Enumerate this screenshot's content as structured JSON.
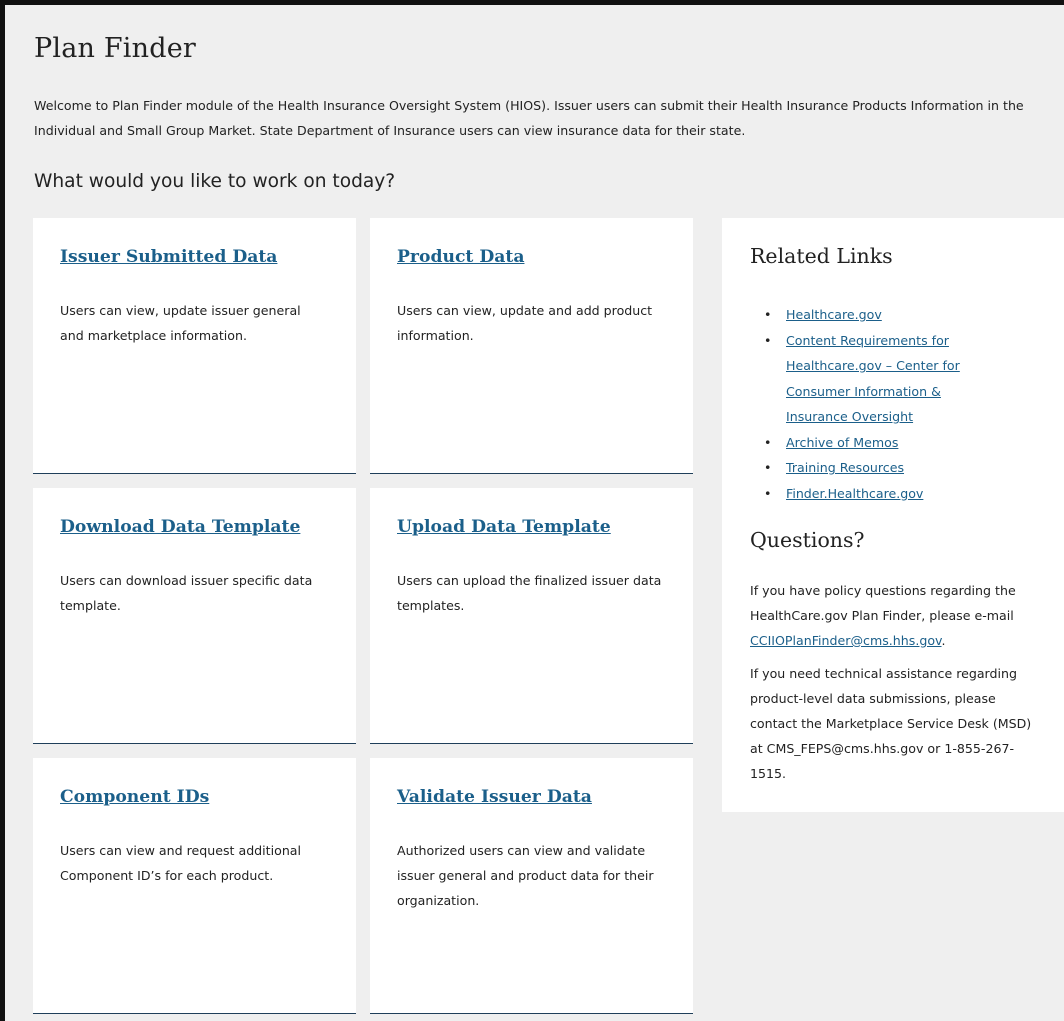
{
  "page": {
    "title": "Plan Finder",
    "intro": "Welcome to Plan Finder module of the Health Insurance Oversight System (HIOS). Issuer users can submit their Health Insurance Products Information in the Individual and Small Group Market. State Department of Insurance users can view insurance data for their state.",
    "prompt": "What would you like to work on today?"
  },
  "cards": [
    {
      "title": "Issuer Submitted Data",
      "description": "Users can view, update issuer general and marketplace information."
    },
    {
      "title": "Product Data",
      "description": "Users can view, update and add product information."
    },
    {
      "title": "Download Data Template",
      "description": "Users can download issuer specific data template."
    },
    {
      "title": "Upload Data Template",
      "description": "Users can upload the finalized issuer data templates."
    },
    {
      "title": "Component IDs",
      "description": "Users can view and request additional Component ID’s for each product."
    },
    {
      "title": "Validate Issuer Data",
      "description": "Authorized users can view and validate issuer general and product data for their organization."
    }
  ],
  "related": {
    "heading": "Related Links",
    "links": [
      "Healthcare.gov",
      "Content Requirements for Healthcare.gov – Center for Consumer Information & Insurance Oversight",
      "Archive of Memos",
      "Training Resources",
      "Finder.Healthcare.gov"
    ]
  },
  "questions": {
    "heading": "Questions?",
    "p1_text": "If you have policy questions regarding the HealthCare.gov Plan Finder, please e-mail ",
    "p1_link": "CCIIOPlanFinder@cms.hhs.gov",
    "p1_end": ".",
    "p2_text": "If you need technical assistance regarding product-level data submissions, please contact the Marketplace Service Desk (MSD) at CMS_FEPS@cms.hhs.gov or 1-855-267-1515."
  },
  "colors": {
    "link": "#1b5f8a",
    "background": "#efefef",
    "card": "#ffffff",
    "card_border": "#1f3f5a"
  }
}
